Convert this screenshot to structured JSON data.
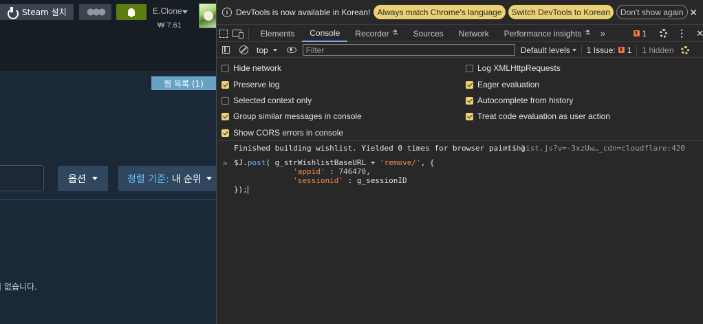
{
  "steam": {
    "install_button": "Steam 설치",
    "account_name": "E.Clone",
    "wallet_balance": "₩ 7.61",
    "wishlist_tab": "찜 목록 (1)",
    "options_button": "옵션",
    "sort_label": "정렬 기준:",
    "sort_value": "내 순위",
    "empty_message": "아이템이 없습니다."
  },
  "devtools": {
    "infobar": {
      "message": "DevTools is now available in Korean!",
      "match_language": "Always match Chrome's language",
      "switch_language": "Switch DevTools to Korean",
      "dont_show": "Don't show again",
      "close": "✕"
    },
    "tabs": [
      {
        "label": "Elements"
      },
      {
        "label": "Console"
      },
      {
        "label": "Recorder"
      },
      {
        "label": "Sources"
      },
      {
        "label": "Network"
      },
      {
        "label": "Performance insights"
      }
    ],
    "more_tabs": "»",
    "issues_count": "1",
    "toolbar": {
      "context": "top",
      "filter_placeholder": "Filter",
      "default_levels": "Default levels",
      "issues_label": "1 Issue:",
      "issues_num": "1",
      "hidden": "1 hidden"
    },
    "settings": [
      {
        "label": "Hide network",
        "checked": false
      },
      {
        "label": "Log XMLHttpRequests",
        "checked": false
      },
      {
        "label": "Preserve log",
        "checked": true
      },
      {
        "label": "Eager evaluation",
        "checked": true
      },
      {
        "label": "Selected context only",
        "checked": false
      },
      {
        "label": "Autocomplete from history",
        "checked": true
      },
      {
        "label": "Group similar messages in console",
        "checked": true
      },
      {
        "label": "Treat code evaluation as user action",
        "checked": true
      },
      {
        "label": "Show CORS errors in console",
        "checked": true
      }
    ],
    "console": {
      "log_message": "Finished building wishlist. Yielded 0 times for browser painting",
      "log_source": "wishlist.js?v=-3xzUw…_cdn=cloudflare:420",
      "prompt": ">",
      "code": {
        "l1_a": "$J.",
        "l1_fn": "post",
        "l1_b": "( g_strWishlistBaseURL + ",
        "l1_str": "'remove/'",
        "l1_c": ", {",
        "l2_key": "'appid'",
        "l2_sep": " : ",
        "l2_num": "746470",
        "l2_end": ",",
        "l3_key": "'sessionid'",
        "l3_rest": " : g_sessionID",
        "l4": "});"
      }
    }
  },
  "colors": {
    "steam_bg": "#1b2838",
    "devtools_bg": "#282828",
    "accent_yellow": "#ecd074",
    "active_tab_underline": "#7cacf8",
    "steam_green": "#5c7e10",
    "sort_label_blue": "#67c1f5"
  },
  "icons": [
    "download-icon",
    "friends-icon",
    "bell-icon",
    "info-icon",
    "inspect-icon",
    "device-toggle-icon",
    "flask-icon",
    "issue-flag-icon",
    "gear-icon",
    "kebab-icon",
    "close-icon",
    "sidebar-icon",
    "clear-icon",
    "eye-icon"
  ]
}
